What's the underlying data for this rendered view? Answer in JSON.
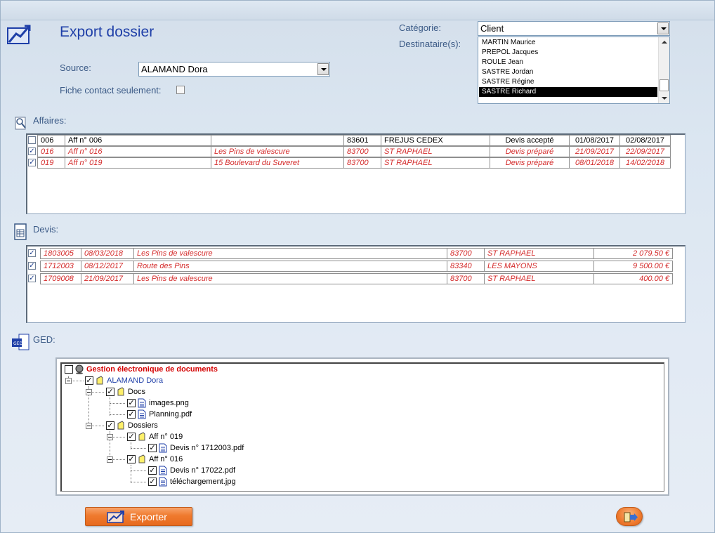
{
  "header": {
    "title": "Export dossier"
  },
  "source": {
    "label": "Source:",
    "value": "ALAMAND Dora"
  },
  "fiche": {
    "label": "Fiche contact seulement:",
    "checked": false
  },
  "categorie": {
    "label": "Catégorie:",
    "value": "Client"
  },
  "destinataires": {
    "label": "Destinataire(s):",
    "items": [
      "MARTIN Maurice",
      "PREPOL Jacques",
      "ROULE Jean",
      "SASTRE Jordan",
      "SASTRE Régine",
      "SASTRE Richard"
    ],
    "selected": "SASTRE Richard"
  },
  "affaires": {
    "label": "Affaires:",
    "rows": [
      {
        "checked": false,
        "code": "006",
        "name": "Aff n° 006",
        "address": "",
        "cp": "83601",
        "city": "FREJUS CEDEX",
        "status": "Devis accepté",
        "date1": "01/08/2017",
        "date2": "02/08/2017",
        "highlight": false
      },
      {
        "checked": true,
        "code": "016",
        "name": "Aff n° 016",
        "address": "Les Pins de valescure",
        "cp": "83700",
        "city": "ST RAPHAEL",
        "status": "Devis préparé",
        "date1": "21/09/2017",
        "date2": "22/09/2017",
        "highlight": true
      },
      {
        "checked": true,
        "code": "019",
        "name": "Aff n° 019",
        "address": "15 Boulevard du Suveret",
        "cp": "83700",
        "city": "ST RAPHAEL",
        "status": "Devis préparé",
        "date1": "08/01/2018",
        "date2": "14/02/2018",
        "highlight": true
      }
    ]
  },
  "devis": {
    "label": "Devis:",
    "rows": [
      {
        "checked": true,
        "num": "1803005",
        "date": "08/03/2018",
        "address": "Les Pins de valescure",
        "cp": "83700",
        "city": "ST RAPHAEL",
        "amount": "2 079.50 €"
      },
      {
        "checked": true,
        "num": "1712003",
        "date": "08/12/2017",
        "address": "Route des Pins",
        "cp": "83340",
        "city": "LES MAYONS",
        "amount": "9 500.00 €"
      },
      {
        "checked": true,
        "num": "1709008",
        "date": "21/09/2017",
        "address": "Les Pins de valescure",
        "cp": "83700",
        "city": "ST RAPHAEL",
        "amount": "400.00 €"
      }
    ]
  },
  "ged": {
    "label": "GED:",
    "root": "Gestion électronique de documents",
    "contact": "ALAMAND Dora",
    "docs_folder": "Docs",
    "docs_files": [
      "images.png",
      "Planning.pdf"
    ],
    "dossiers_folder": "Dossiers",
    "aff019": "Aff n° 019",
    "aff019_files": [
      "Devis n° 1712003.pdf"
    ],
    "aff016": "Aff n° 016",
    "aff016_files": [
      "Devis n° 17022.pdf",
      "téléchargement.jpg"
    ]
  },
  "buttons": {
    "export": "Exporter"
  },
  "colors": {
    "title": "#1f3fa8",
    "highlight_row": "#d42b2b",
    "ged_root": "#d40000",
    "ged_contact": "#1f3fa8",
    "export_button": "#ef7a2e"
  },
  "icons": {
    "form": "export-folder-icon",
    "affaires": "affaires-icon",
    "devis": "devis-icon",
    "ged": "ged-icon",
    "exit": "exit-door-icon"
  }
}
